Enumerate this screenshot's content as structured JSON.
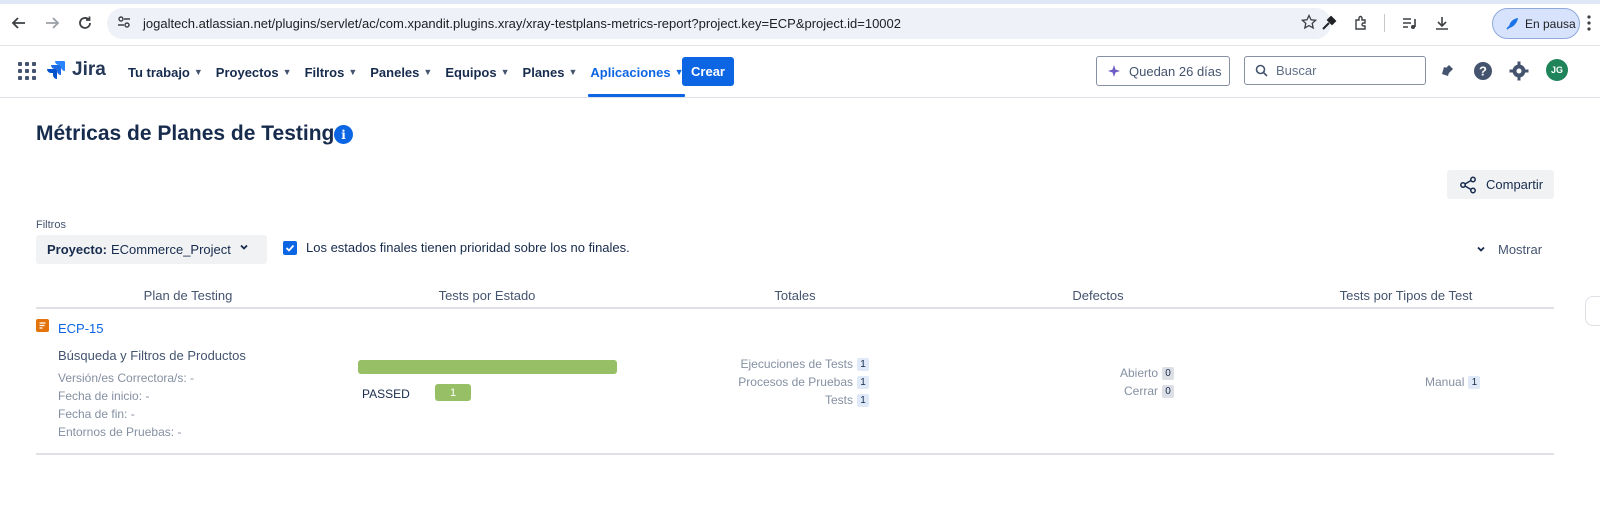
{
  "browser": {
    "url": "jogaltech.atlassian.net/plugins/servlet/ac/com.xpandit.plugins.xray/xray-testplans-metrics-report?project.key=ECP&project.id=10002",
    "pause_label": "En pausa",
    "icons": [
      "back-arrow-icon",
      "forward-arrow-icon",
      "reload-icon",
      "site-info-icon",
      "star-icon",
      "eyedropper-icon",
      "extensions-icon",
      "media-control-icon",
      "download-icon",
      "menu-icon"
    ]
  },
  "header": {
    "product": "Jira",
    "nav": [
      {
        "label": "Tu trabajo",
        "active": false
      },
      {
        "label": "Proyectos",
        "active": false
      },
      {
        "label": "Filtros",
        "active": false
      },
      {
        "label": "Paneles",
        "active": false
      },
      {
        "label": "Equipos",
        "active": false
      },
      {
        "label": "Planes",
        "active": false
      },
      {
        "label": "Aplicaciones",
        "active": true
      }
    ],
    "create_label": "Crear",
    "trial_label": "Quedan 26 días",
    "search_placeholder": "Buscar",
    "avatar_initials": "JG",
    "icons": [
      "notifications-icon",
      "help-icon",
      "settings-icon"
    ]
  },
  "page": {
    "title": "Métricas de Planes de Testing",
    "share_label": "Compartir",
    "filters_label": "Filtros",
    "project_label": "Proyecto:",
    "project_value": "ECommerce_Project",
    "checkbox_label": "Los estados finales tienen prioridad sobre los no finales.",
    "checkbox_checked": true,
    "show_label": "Mostrar"
  },
  "table": {
    "columns": [
      "Plan de Testing",
      "Tests por Estado",
      "Totales",
      "Defectos",
      "Tests por Tipos de Test"
    ],
    "rows": [
      {
        "key": "ECP-15",
        "summary": "Búsqueda y Filtros de Productos",
        "meta": [
          "Versión/es Correctora/s: -",
          "Fecha de inicio: -",
          "Fecha de fin: -",
          "Entornos de Pruebas: -"
        ],
        "status": {
          "label": "PASSED",
          "count": "1",
          "fraction": 1.0,
          "color": "#97c066"
        },
        "totals": [
          {
            "label": "Ejecuciones de Tests",
            "value": "1"
          },
          {
            "label": "Procesos de Pruebas",
            "value": "1"
          },
          {
            "label": "Tests",
            "value": "1"
          }
        ],
        "defects": [
          {
            "label": "Abierto",
            "value": "0"
          },
          {
            "label": "Cerrar",
            "value": "0"
          }
        ],
        "types": [
          {
            "label": "Manual",
            "value": "1"
          }
        ]
      }
    ]
  },
  "colors": {
    "accent": "#0c66e4",
    "passed": "#97c066",
    "issue_icon": "#e2740b"
  }
}
